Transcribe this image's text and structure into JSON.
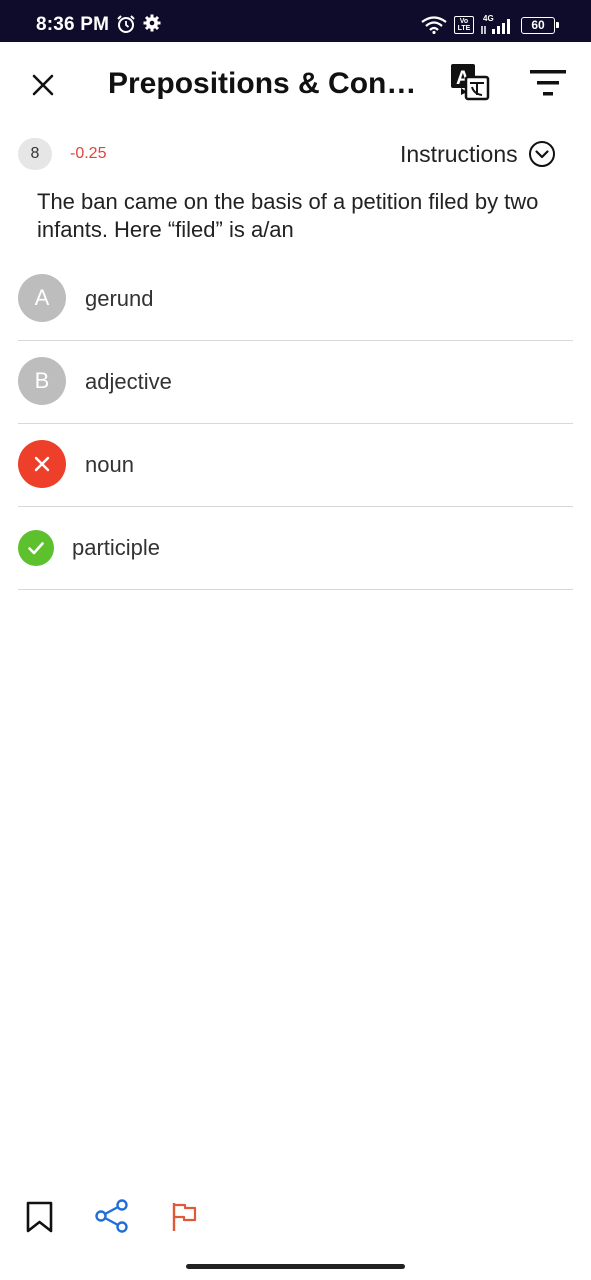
{
  "status_bar": {
    "time": "8:36 PM",
    "volte": "Vo LTE",
    "network": "4G",
    "battery": "60",
    "icons": [
      "alarm-icon",
      "settings-icon",
      "wifi-icon",
      "volte-icon",
      "signal-icon",
      "battery-icon"
    ]
  },
  "app_bar": {
    "title": "Prepositions & Conju...",
    "close_icon": "close-icon",
    "translate_icon": "translate-icon",
    "filter_icon": "filter-icon"
  },
  "question": {
    "number": "8",
    "negative_marks": "-0.25",
    "instructions_label": "Instructions",
    "text": "The ban came on the basis of a petition filed by two infants. Here “filed” is a/an",
    "options": [
      {
        "marker": "A",
        "label": "gerund",
        "state": "default"
      },
      {
        "marker": "B",
        "label": "adjective",
        "state": "default"
      },
      {
        "marker": "",
        "label": "noun",
        "state": "wrong"
      },
      {
        "marker": "",
        "label": "participle",
        "state": "correct"
      }
    ]
  },
  "bottom_bar": {
    "icons": [
      "bookmark-icon",
      "share-icon",
      "flag-icon"
    ]
  },
  "colors": {
    "status_bar_bg": "#0f0b2a",
    "wrong": "#ee3f2a",
    "correct": "#5cc12d",
    "option_letter_bg": "#bdbdbd",
    "negative_mark": "#e0443a",
    "share": "#1e6fd9",
    "flag": "#e05a3a"
  }
}
